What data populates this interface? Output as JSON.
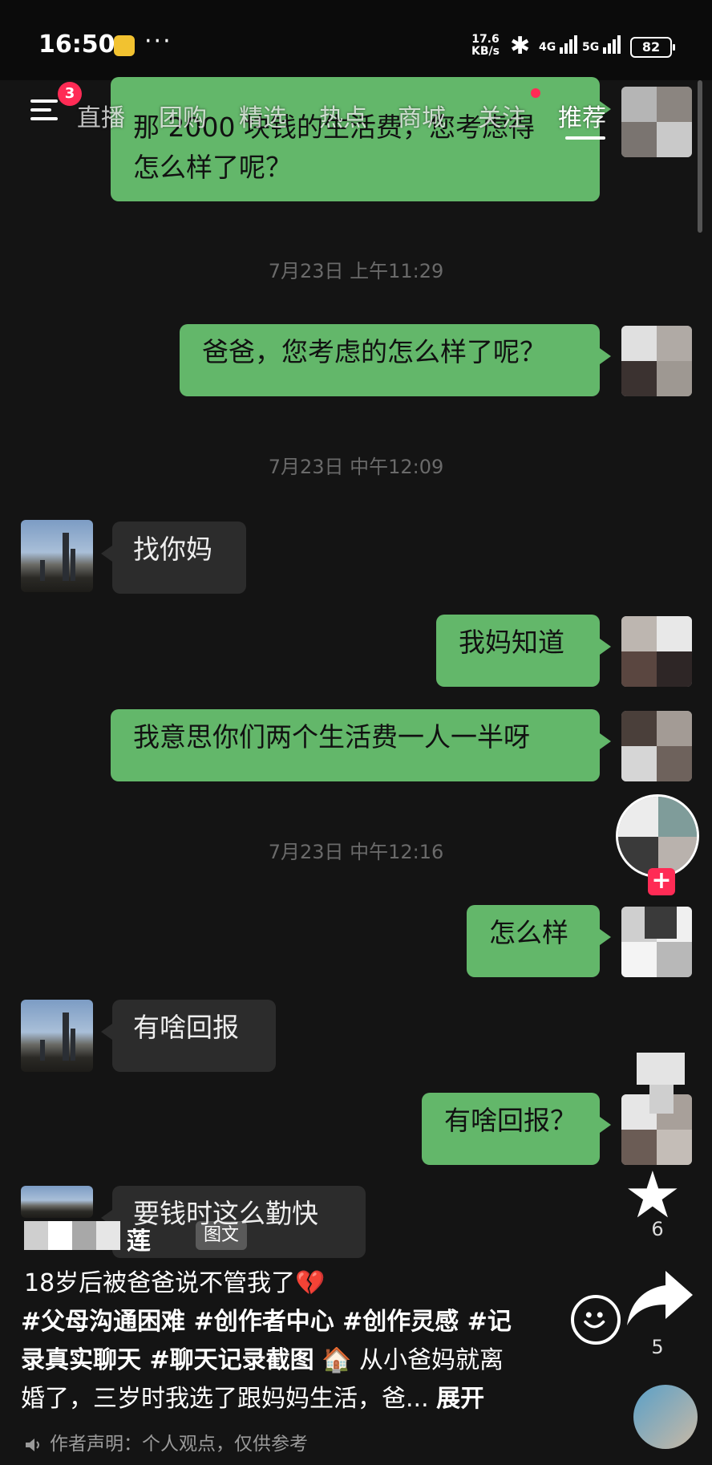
{
  "status_bar": {
    "time": "16:50",
    "dots": "···",
    "net_speed_value": "17.6",
    "net_speed_unit": "KB/s",
    "signal_1_label": "4G",
    "signal_2_label": "5G",
    "battery": "82"
  },
  "nav": {
    "menu_badge": "3",
    "tabs": [
      "直播",
      "团购",
      "精选",
      "热点",
      "商城",
      "关注",
      "推荐"
    ],
    "active_tab": "推荐"
  },
  "chat": {
    "messages": [
      {
        "from": "me",
        "text_line1": "那 2000 块钱的生活费，您考虑得",
        "text_line2": "怎么样了呢？"
      },
      {
        "from": "me",
        "text": "爸爸，您考虑的怎么样了呢？"
      },
      {
        "from": "dad",
        "text": "找你妈"
      },
      {
        "from": "me",
        "text": "我妈知道"
      },
      {
        "from": "me",
        "text": "我意思你们两个生活费一人一半呀"
      },
      {
        "from": "me",
        "text": "怎么样"
      },
      {
        "from": "dad",
        "text": "有啥回报"
      },
      {
        "from": "me",
        "text": "有啥回报？"
      },
      {
        "from": "dad",
        "text": "要钱时这么勤快"
      }
    ],
    "timestamps": [
      "7月23日 上午11:29",
      "7月23日 中午12:09",
      "7月23日 中午12:16"
    ]
  },
  "rail": {
    "follow_plus": "+",
    "star_count": "6",
    "share_count": "5"
  },
  "caption": {
    "author_name_visible": "莲",
    "post_type": "图文",
    "title": "18岁后被爸爸说不管我了",
    "tags_line1": "#父母沟通困难 #创作者中心 #创作灵感 #记",
    "tags_line2": "录真实聊天 #聊天记录截图",
    "body_line2_tail": "从小爸妈就离",
    "body_line3": "婚了，三岁时我选了跟妈妈生活，爸...",
    "expand": "展开",
    "disclaimer": "作者声明：个人观点，仅供参考"
  },
  "icons": {
    "heart": "broken-heart-icon",
    "house": "house-icon"
  },
  "colors": {
    "bubble_out": "#63b76a",
    "bubble_in": "#2c2c2c",
    "background": "#141414",
    "badge": "#ff2b55"
  }
}
